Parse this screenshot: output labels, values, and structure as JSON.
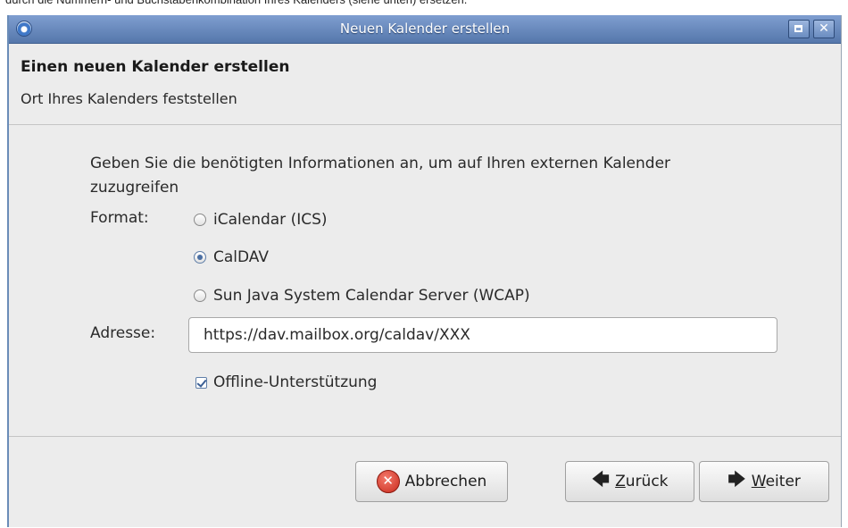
{
  "page_caption": "durch die Nummern- und Buchstabenkombination Ihres Kalenders (siehe unten) ersetzen.",
  "window": {
    "title": "Neuen Kalender erstellen",
    "maximize_symbol": "",
    "close_symbol": "✕"
  },
  "header": {
    "title": "Einen neuen Kalender erstellen",
    "subtitle": "Ort Ihres Kalenders feststellen"
  },
  "form": {
    "intro": "Geben Sie die benötigten Informationen an, um auf Ihren externen Kalender zuzugreifen",
    "format_label": "Format:",
    "formats": [
      {
        "label": "iCalendar (ICS)",
        "checked": false
      },
      {
        "label": "CalDAV",
        "checked": true
      },
      {
        "label": "Sun Java System Calendar Server (WCAP)",
        "checked": false
      }
    ],
    "address_label": "Adresse:",
    "address_value": "https://dav.mailbox.org/caldav/XXX",
    "offline_label": "Offline-Unterstützung",
    "offline_checked": true
  },
  "footer": {
    "cancel_label": "Abbrechen",
    "back_label_underlined": "Z",
    "back_label_rest": "urück",
    "next_label_underlined": "W",
    "next_label_rest": "eiter",
    "back_arrow": "🡄",
    "next_arrow": "🡆"
  },
  "colors": {
    "titlebar": "#5f7fb4",
    "cancel_icon": "#d23a2b"
  }
}
